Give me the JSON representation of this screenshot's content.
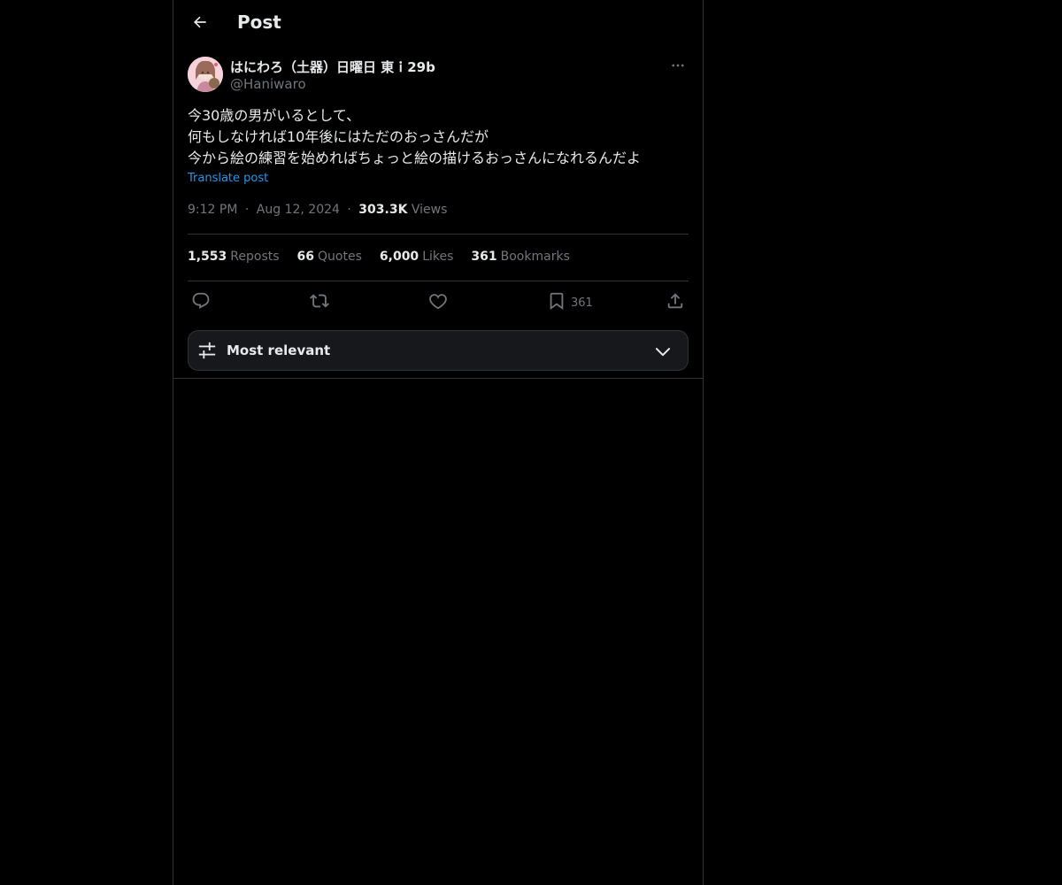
{
  "header": {
    "back_icon": "arrow-left-icon",
    "title": "Post"
  },
  "post": {
    "author": {
      "display_name": "はにわろ（土器）日曜日 東ｉ29b",
      "handle": "@Haniwaro",
      "avatar_icon": "avatar-illustration"
    },
    "more_icon": "more-horizontal-icon",
    "text_lines": [
      "今30歳の男がいるとして、",
      "何もしなければ10年後にはただのおっさんだが",
      "今から絵の練習を始めればちょっと絵の描けるおっさんになれるんだよ"
    ],
    "translate_label": "Translate post",
    "time": "9:12 PM",
    "date": "Aug 12, 2024",
    "views_count": "303.3K",
    "views_label": "Views",
    "separator": "·"
  },
  "stats": {
    "reposts": {
      "count": "1,553",
      "label": "Reposts"
    },
    "quotes": {
      "count": "66",
      "label": "Quotes"
    },
    "likes": {
      "count": "6,000",
      "label": "Likes"
    },
    "bookmarks": {
      "count": "361",
      "label": "Bookmarks"
    }
  },
  "actions": {
    "reply_icon": "reply-icon",
    "repost_icon": "repost-icon",
    "like_icon": "heart-icon",
    "bookmark_icon": "bookmark-icon",
    "bookmark_count": "361",
    "share_icon": "share-icon"
  },
  "sort": {
    "icon": "sliders-icon",
    "label": "Most relevant",
    "chevron_icon": "chevron-down-icon"
  },
  "colors": {
    "background": "#000000",
    "text_primary": "#e7e9ea",
    "text_secondary": "#71767b",
    "accent": "#1d9bf0",
    "border": "#2f3336"
  }
}
